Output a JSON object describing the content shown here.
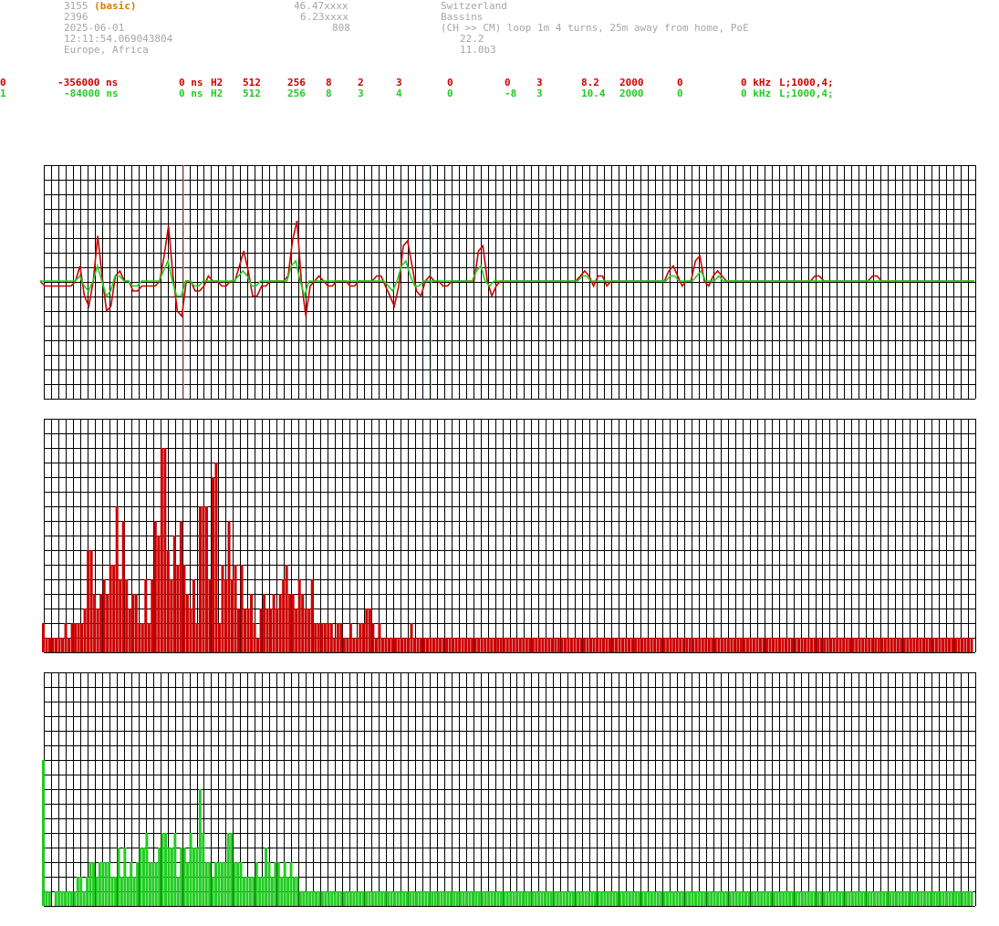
{
  "header": {
    "station_id": "3155",
    "station_tag": "(basic)",
    "line2": "2396",
    "date": "2025-06-01",
    "time": "12:11:54.069043804",
    "region": "Europe, Africa",
    "lat": "46.47xxxx",
    "lon": "6.23xxxx",
    "alt": "808",
    "country": "Switzerland",
    "city": "Bassins",
    "antenna": "(CH >> CM) loop 1m 4 turns, 25m away from home, PoE",
    "val1": "22.2",
    "val2": "11.0b3"
  },
  "channels": [
    {
      "idx": "0",
      "offset": "-356000 ns",
      "delay": "0 ns",
      "filter": "H2",
      "n1": "512",
      "n2": "256",
      "n3": "8",
      "n4": "2",
      "n5": "3",
      "n6": "0",
      "n7": "0",
      "n8": "3",
      "gain": "8.2",
      "rate": "2000",
      "n9": "0",
      "freq": "0 kHz",
      "mode": "L;1000,4;",
      "color": "#cc0000"
    },
    {
      "idx": "1",
      "offset": "-84000 ns",
      "delay": "0 ns",
      "filter": "H2",
      "n1": "512",
      "n2": "256",
      "n3": "8",
      "n4": "3",
      "n5": "4",
      "n6": "0",
      "n7": "-8",
      "n8": "3",
      "gain": "10.4",
      "rate": "2000",
      "n9": "0",
      "freq": "0 kHz",
      "mode": "L;1000,4;",
      "color": "#22cc22"
    }
  ],
  "chart_data": [
    {
      "type": "line",
      "name": "waveform",
      "x_samples": 200,
      "series": [
        {
          "name": "",
          "color": "#cc0000",
          "values": [
            0,
            -1,
            -1,
            -1,
            -1,
            -1,
            -1,
            -1,
            0,
            3,
            -3,
            -5,
            0,
            9,
            1,
            -6,
            -5,
            1,
            2,
            0,
            0,
            -2,
            -2,
            -1,
            -1,
            -1,
            -1,
            0,
            5,
            11,
            1,
            -6,
            -7,
            0,
            0,
            -2,
            -2,
            -1,
            1,
            0,
            0,
            -1,
            -1,
            0,
            0,
            3,
            6,
            2,
            -3,
            -3,
            -1,
            -1,
            0,
            0,
            0,
            0,
            1,
            8,
            12,
            0,
            -7,
            -1,
            0,
            1,
            0,
            -1,
            -1,
            0,
            0,
            0,
            -1,
            -1,
            0,
            0,
            0,
            0,
            1,
            1,
            -1,
            -3,
            -5,
            -1,
            7,
            8,
            3,
            -2,
            -3,
            0,
            1,
            0,
            0,
            -1,
            -1,
            0,
            0,
            0,
            0,
            0,
            0,
            6,
            7,
            0,
            -3,
            -1,
            0,
            0,
            0,
            0,
            0,
            0,
            0,
            0,
            0,
            0,
            0,
            0,
            0,
            0,
            0,
            0,
            0,
            0,
            1,
            2,
            1,
            -1,
            1,
            1,
            -1,
            0,
            0,
            0,
            0,
            0,
            0,
            0,
            0,
            0,
            0,
            0,
            0,
            0,
            2,
            3,
            1,
            -1,
            0,
            0,
            4,
            5,
            0,
            -1,
            1,
            2,
            1,
            0,
            0,
            0,
            0,
            0,
            0,
            0,
            0,
            0,
            0,
            0,
            0,
            0,
            0,
            0,
            0,
            0,
            0,
            0,
            0,
            1,
            1,
            0,
            0,
            0,
            0,
            0,
            0,
            0,
            0,
            0,
            0,
            0,
            1,
            1,
            0,
            0,
            0,
            0,
            0,
            0,
            0,
            0,
            0,
            0,
            0,
            0,
            0,
            0,
            0,
            0,
            0,
            0,
            0,
            0,
            0,
            0
          ]
        },
        {
          "name": "",
          "color": "#22cc22",
          "values": [
            0,
            0,
            0,
            0,
            0,
            0,
            0,
            0,
            0,
            1,
            -1,
            -2,
            0,
            3,
            0,
            -3,
            -2,
            1,
            1,
            0,
            0,
            -1,
            -1,
            0,
            0,
            0,
            0,
            0,
            2,
            4,
            0,
            -3,
            -3,
            0,
            0,
            -1,
            -1,
            0,
            0,
            0,
            0,
            0,
            0,
            0,
            0,
            1,
            2,
            1,
            -1,
            -1,
            0,
            0,
            0,
            0,
            0,
            0,
            0,
            3,
            4,
            0,
            -3,
            0,
            0,
            0,
            0,
            0,
            0,
            0,
            0,
            0,
            0,
            0,
            0,
            0,
            0,
            0,
            0,
            0,
            0,
            -1,
            -2,
            0,
            3,
            4,
            1,
            -1,
            -1,
            0,
            0,
            0,
            0,
            0,
            0,
            0,
            0,
            0,
            0,
            0,
            0,
            2,
            3,
            0,
            -1,
            0,
            0,
            0,
            0,
            0,
            0,
            0,
            0,
            0,
            0,
            0,
            0,
            0,
            0,
            0,
            0,
            0,
            0,
            0,
            0,
            1,
            1,
            0,
            0,
            0,
            0,
            0,
            0,
            0,
            0,
            0,
            0,
            0,
            0,
            0,
            0,
            0,
            0,
            0,
            0,
            1,
            1,
            0,
            0,
            0,
            0,
            1,
            2,
            0,
            0,
            0,
            1,
            0,
            0,
            0,
            0,
            0,
            0,
            0,
            0,
            0,
            0,
            0,
            0,
            0,
            0,
            0,
            0,
            0,
            0,
            0,
            0,
            0,
            0,
            0,
            0,
            0,
            0,
            0,
            0,
            0,
            0,
            0,
            0,
            0,
            0,
            0,
            0,
            0,
            0,
            0,
            0,
            0,
            0,
            0,
            0,
            0,
            0,
            0,
            0,
            0,
            0,
            0,
            0,
            0,
            0,
            0,
            0,
            0,
            0
          ]
        }
      ],
      "markers": [
        {
          "color": "#ff9999",
          "pos": 0.15
        },
        {
          "color": "#99ee99",
          "pos": 0.416
        }
      ]
    },
    {
      "type": "bar",
      "name": "spectrum-red",
      "color": "#cc0000",
      "ylim": [
        0,
        16
      ],
      "values": [
        2,
        1,
        1,
        1,
        1,
        1,
        1,
        2,
        1,
        2,
        2,
        2,
        2,
        3,
        7,
        7,
        4,
        3,
        4,
        5,
        4,
        6,
        6,
        10,
        5,
        9,
        5,
        3,
        4,
        4,
        2,
        2,
        5,
        2,
        5,
        9,
        8,
        14,
        14,
        7,
        5,
        8,
        6,
        9,
        6,
        4,
        3,
        5,
        2,
        10,
        10,
        10,
        5,
        12,
        13,
        2,
        6,
        5,
        9,
        5,
        6,
        3,
        6,
        3,
        3,
        4,
        2,
        1,
        3,
        4,
        3,
        3,
        4,
        3,
        4,
        5,
        6,
        4,
        4,
        3,
        5,
        4,
        3,
        3,
        5,
        2,
        2,
        2,
        2,
        2,
        2,
        1,
        2,
        2,
        1,
        1,
        2,
        1,
        1,
        2,
        2,
        3,
        3,
        2,
        1,
        2,
        1,
        1,
        1,
        1,
        1,
        1,
        1,
        1,
        1,
        2,
        1,
        1,
        1,
        1,
        1,
        1,
        1,
        1,
        1,
        1,
        1,
        1,
        1,
        1,
        1,
        1,
        1,
        1,
        1,
        1,
        1,
        1,
        1,
        1,
        1,
        1,
        1,
        1,
        1,
        1,
        1,
        1,
        1,
        1,
        1,
        1,
        1,
        1,
        1,
        1,
        1,
        1,
        1,
        1,
        1,
        1,
        1,
        1,
        1,
        1,
        1,
        1,
        1,
        1,
        1,
        1,
        1,
        1,
        1,
        1,
        1,
        1,
        1,
        1,
        1,
        1,
        1,
        1,
        1,
        1,
        1,
        1,
        1,
        1,
        1,
        1,
        1,
        1,
        1,
        1,
        1,
        1,
        1,
        1,
        1,
        1,
        1,
        1,
        1,
        1,
        1,
        1,
        1,
        1,
        1,
        1,
        1,
        1,
        1,
        1,
        1,
        1,
        1,
        1,
        1,
        1,
        1,
        1,
        1,
        1,
        1,
        1,
        1,
        1,
        1,
        1,
        1,
        1,
        1,
        1,
        1,
        1,
        1,
        1,
        1,
        1,
        1,
        1,
        1,
        1,
        1,
        1,
        1,
        1,
        1,
        1,
        1,
        1,
        1,
        1,
        1,
        1,
        1,
        1,
        1,
        1,
        1,
        1,
        1,
        1,
        1,
        1,
        1,
        1,
        1,
        1,
        1,
        1,
        1,
        1,
        1,
        1,
        1,
        1,
        1,
        1,
        1,
        1,
        1,
        1,
        1,
        1,
        1,
        1,
        1
      ]
    },
    {
      "type": "bar",
      "name": "spectrum-green",
      "color": "#22cc22",
      "ylim": [
        0,
        16
      ],
      "values": [
        10,
        1,
        1,
        0,
        1,
        1,
        1,
        1,
        1,
        1,
        1,
        2,
        2,
        1,
        2,
        3,
        3,
        2,
        3,
        3,
        3,
        3,
        2,
        2,
        4,
        2,
        4,
        2,
        3,
        2,
        3,
        4,
        4,
        5,
        3,
        3,
        3,
        4,
        5,
        5,
        4,
        4,
        5,
        2,
        4,
        4,
        3,
        5,
        4,
        4,
        8,
        5,
        3,
        3,
        2,
        3,
        3,
        3,
        3,
        5,
        5,
        3,
        3,
        3,
        2,
        2,
        2,
        2,
        3,
        2,
        2,
        4,
        3,
        2,
        3,
        3,
        2,
        3,
        2,
        3,
        2,
        2,
        1,
        1,
        1,
        1,
        1,
        1,
        1,
        1,
        1,
        1,
        1,
        1,
        1,
        1,
        1,
        1,
        1,
        1,
        1,
        1,
        1,
        1,
        1,
        1,
        1,
        1,
        1,
        1,
        1,
        1,
        1,
        1,
        1,
        1,
        1,
        1,
        1,
        1,
        1,
        1,
        1,
        1,
        1,
        1,
        1,
        1,
        1,
        1,
        1,
        1,
        1,
        1,
        1,
        1,
        1,
        1,
        1,
        1,
        1,
        1,
        1,
        1,
        1,
        1,
        1,
        1,
        1,
        1,
        1,
        1,
        1,
        1,
        1,
        1,
        1,
        1,
        1,
        1,
        1,
        1,
        1,
        1,
        1,
        1,
        1,
        1,
        1,
        1,
        1,
        1,
        1,
        1,
        1,
        1,
        1,
        1,
        1,
        1,
        1,
        1,
        1,
        1,
        1,
        1,
        1,
        1,
        1,
        1,
        1,
        1,
        1,
        1,
        1,
        1,
        1,
        1,
        1,
        1,
        1,
        1,
        1,
        1,
        1,
        1,
        1,
        1,
        1,
        1,
        1,
        1,
        1,
        1,
        1,
        1,
        1,
        1,
        1,
        1,
        1,
        1,
        1,
        1,
        1,
        1,
        1,
        1,
        1,
        1,
        1,
        1,
        1,
        1,
        1,
        1,
        1,
        1,
        1,
        1,
        1,
        1,
        1,
        1,
        1,
        1,
        1,
        1,
        1,
        1,
        1,
        1,
        1,
        1,
        1,
        1,
        1,
        1,
        1,
        1,
        1,
        1,
        1,
        1,
        1,
        1,
        1,
        1,
        1,
        1,
        1,
        1,
        1,
        1,
        1,
        1,
        1,
        1,
        1,
        1,
        1,
        1,
        1,
        1,
        1,
        1,
        1,
        1,
        1,
        1,
        1,
        1,
        1,
        1,
        1,
        1,
        1
      ]
    }
  ]
}
